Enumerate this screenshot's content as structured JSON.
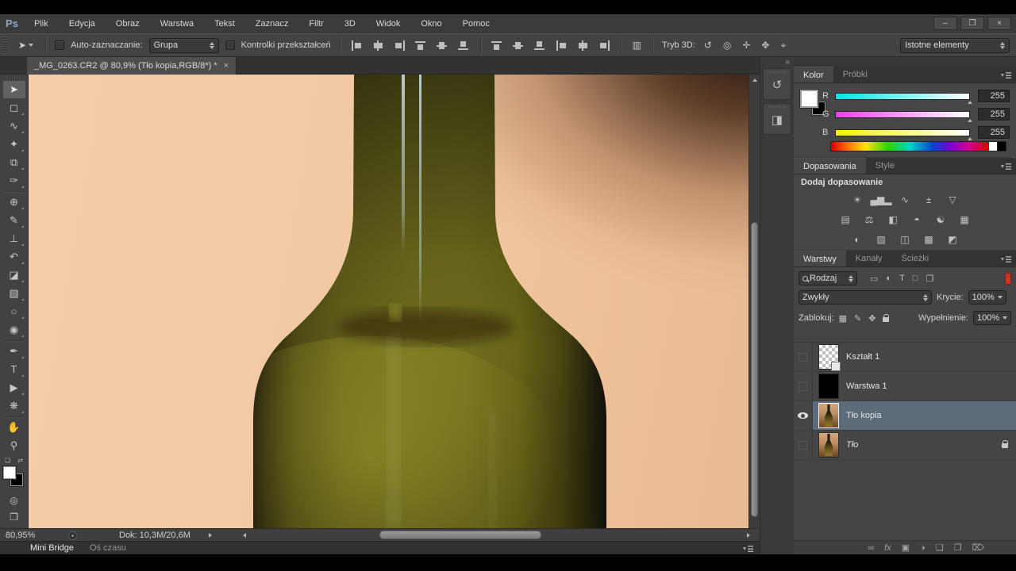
{
  "window": {
    "minimize": "–",
    "restore": "❐",
    "close": "×"
  },
  "menubar": {
    "logo": "Ps",
    "items": [
      "Plik",
      "Edycja",
      "Obraz",
      "Warstwa",
      "Tekst",
      "Zaznacz",
      "Filtr",
      "3D",
      "Widok",
      "Okno",
      "Pomoc"
    ]
  },
  "optionsbar": {
    "tool_icon": "➤",
    "auto_select_label": "Auto-zaznaczanie:",
    "group_value": "Grupa",
    "transform_label": "Kontrolki przekształceń",
    "mode3d_label": "Tryb 3D:",
    "mode3d_icons": [
      "↺",
      "◎",
      "✛",
      "✥",
      "⌖"
    ],
    "workspace_value": "Istotne elementy"
  },
  "document_tab": {
    "title": "_MG_0263.CR2 @ 80,9% (Tło kopia,RGB/8*) *",
    "close_icon": "×"
  },
  "tools": [
    {
      "name": "move-tool",
      "glyph": "➤"
    },
    {
      "name": "rectangular-marquee-tool",
      "glyph": "◻"
    },
    {
      "name": "lasso-tool",
      "glyph": "∿"
    },
    {
      "name": "quick-selection-tool",
      "glyph": "✦"
    },
    {
      "name": "crop-tool",
      "glyph": "⧉"
    },
    {
      "name": "eyedropper-tool",
      "glyph": "✑"
    },
    {
      "name": "healing-brush-tool",
      "glyph": "⊕"
    },
    {
      "name": "brush-tool",
      "glyph": "✎"
    },
    {
      "name": "clone-stamp-tool",
      "glyph": "⊥"
    },
    {
      "name": "history-brush-tool",
      "glyph": "↶"
    },
    {
      "name": "eraser-tool",
      "glyph": "◪"
    },
    {
      "name": "gradient-tool",
      "glyph": "▧"
    },
    {
      "name": "blur-tool",
      "glyph": "○"
    },
    {
      "name": "dodge-tool",
      "glyph": "◉"
    },
    {
      "name": "pen-tool",
      "glyph": "✒"
    },
    {
      "name": "type-tool",
      "glyph": "T"
    },
    {
      "name": "path-selection-tool",
      "glyph": "▶"
    },
    {
      "name": "shape-tool",
      "glyph": "❋"
    },
    {
      "name": "hand-tool",
      "glyph": "✋"
    },
    {
      "name": "zoom-tool",
      "glyph": "⚲"
    }
  ],
  "icons": {
    "distribute": "▥",
    "default_swatches": "❏",
    "swap_swatches": "⇄",
    "quick_mask": "◎",
    "screen_mode": "❐",
    "collapse_panels": "«",
    "history_panel": "↺",
    "properties_panel": "◨"
  },
  "color_panel": {
    "tabs": [
      "Kolor",
      "Próbki"
    ],
    "foreground_color": "#ffffff",
    "background_color": "#000000",
    "channels": [
      {
        "label": "R",
        "value": "255"
      },
      {
        "label": "G",
        "value": "255"
      },
      {
        "label": "B",
        "value": "255"
      }
    ]
  },
  "adjustments_panel": {
    "tabs": [
      "Dopasowania",
      "Style"
    ],
    "header": "Dodaj dopasowanie",
    "icons_row1": [
      "☀",
      "▄▆▂",
      "∿",
      "±",
      "▽"
    ],
    "icons_row2": [
      "▤",
      "⚖",
      "◧",
      "◓",
      "☯",
      "▦"
    ],
    "icons_row3": [
      "◐",
      "▨",
      "◫",
      "▩",
      "◩"
    ]
  },
  "layers_panel": {
    "tabs": [
      "Warstwy",
      "Kanały",
      "Ścieżki"
    ],
    "filter_label": "Rodzaj",
    "filter_icons": [
      "▭",
      "◐",
      "T",
      "□",
      "❐"
    ],
    "blend_mode": "Zwykły",
    "opacity_label": "Krycie:",
    "opacity_value": "100%",
    "lock_label": "Zablokuj:",
    "lock_icons": [
      "▦",
      "✎",
      "✥"
    ],
    "fill_label": "Wypełnienie:",
    "fill_value": "100%",
    "layers": [
      {
        "name": "Kształt 1",
        "visible": false,
        "thumb": "checker"
      },
      {
        "name": "Warstwa 1",
        "visible": false,
        "thumb": "black"
      },
      {
        "name": "Tło kopia",
        "visible": true,
        "thumb": "bottle",
        "selected": true
      },
      {
        "name": "Tło",
        "visible": false,
        "thumb": "bottle",
        "locked": true
      }
    ],
    "footer_icons": [
      "∞",
      "fx",
      "▣",
      "◑",
      "❏",
      "❐",
      "⌦"
    ]
  },
  "statusbar": {
    "zoom": "80,95%",
    "doc_info": "Dok: 10,3M/20,6M"
  },
  "bottom_tabs": {
    "active": "Mini Bridge",
    "inactive": "Oś czasu"
  },
  "colors": {
    "layer_selection": "#5c6b7a",
    "canvas_background": "#f0c6a3",
    "bottle_olive": "#6f6c1e",
    "panel_background": "#454545",
    "filter_toggle_red": "#c13a2e"
  }
}
